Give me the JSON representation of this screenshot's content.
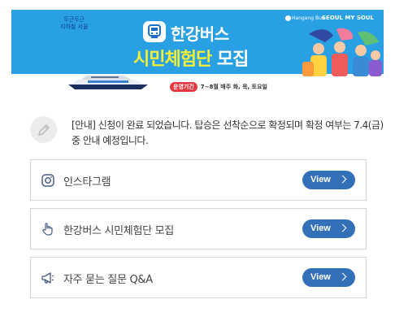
{
  "banner": {
    "left_logo_line1": "두근두근",
    "left_logo_line2": "지하철 서울",
    "brand": "한강버스",
    "headline_part1": "시민체험단",
    "headline_part2": " 모집",
    "partner1": "Hangang Bus",
    "partner2": "SEOUL MY SOUL",
    "period_tag": "운영기간",
    "period_text": "7~8월 매주 화, 목, 토요일",
    "colors": {
      "background": "#2aa0e4",
      "headline_accent": "#f4ef35",
      "tag": "#e8343c"
    }
  },
  "notice": {
    "icon": "pencil-icon",
    "text": "[안내] 신청이 완료 되었습니다. 탑승은 선착순으로 확정되며 확정 여부는 7.4(금) 중 안내 예정입니다."
  },
  "links": [
    {
      "icon": "instagram-icon",
      "label": "인스타그램",
      "button": "View"
    },
    {
      "icon": "pointer-hand-icon",
      "label": "한강버스 시민체험단 모집",
      "button": "View"
    },
    {
      "icon": "megaphone-icon",
      "label": "자주 묻는 질문 Q&A",
      "button": "View"
    }
  ],
  "colors": {
    "button": "#3470b8",
    "border": "#d6d6d6"
  }
}
